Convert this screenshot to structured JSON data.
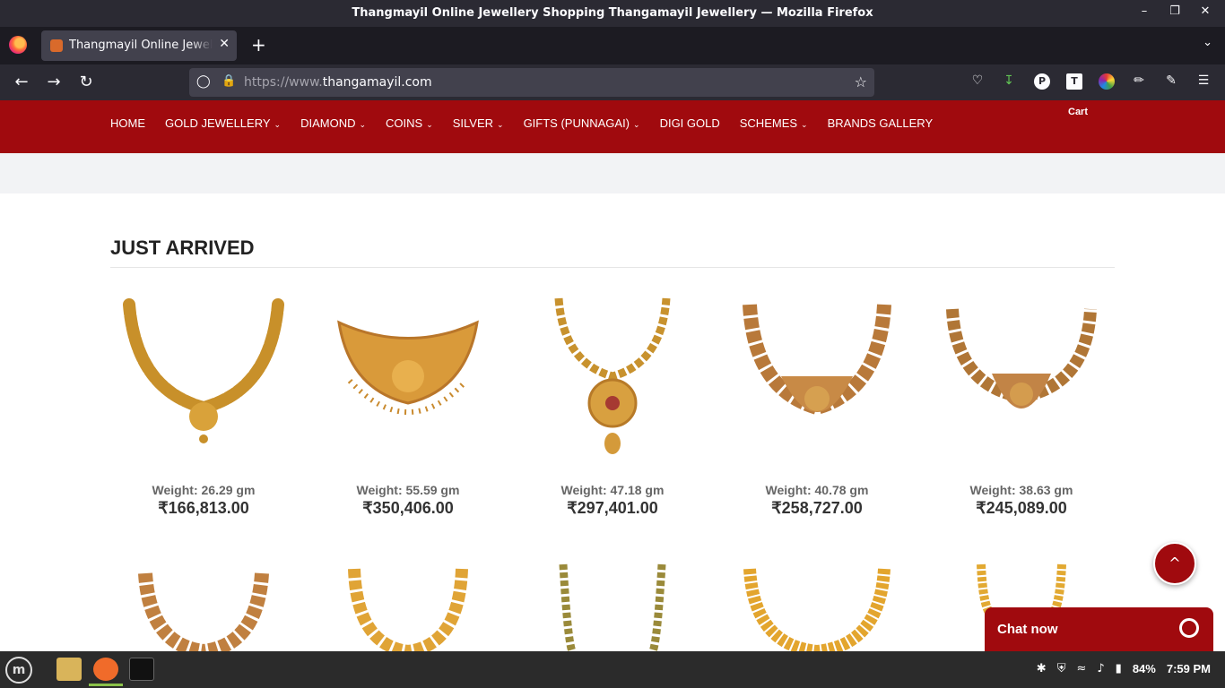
{
  "window": {
    "title": "Thangmayil Online Jewellery Shopping Thangamayil Jewellery — Mozilla Firefox"
  },
  "tab": {
    "label": "Thangmayil Online Jewellery Shopping Thangamayil Jewellery"
  },
  "urlbar": {
    "prefix": "https://www.",
    "domain": "thangamayil.com"
  },
  "site": {
    "menu": [
      {
        "label": "HOME",
        "dropdown": false
      },
      {
        "label": "GOLD JEWELLERY",
        "dropdown": true
      },
      {
        "label": "DIAMOND",
        "dropdown": true
      },
      {
        "label": "COINS",
        "dropdown": true
      },
      {
        "label": "SILVER",
        "dropdown": true
      },
      {
        "label": "GIFTS (PUNNAGAI)",
        "dropdown": true
      },
      {
        "label": "DIGI GOLD",
        "dropdown": false
      },
      {
        "label": "SCHEMES",
        "dropdown": true
      },
      {
        "label": "BRANDS GALLERY",
        "dropdown": false
      }
    ],
    "cart_label": "Cart",
    "brand_color": "#a00a0e"
  },
  "section": {
    "title": "JUST ARRIVED"
  },
  "products": [
    {
      "weight": "Weight: 26.29 gm",
      "price": "₹166,813.00"
    },
    {
      "weight": "Weight: 55.59 gm",
      "price": "₹350,406.00"
    },
    {
      "weight": "Weight: 47.18 gm",
      "price": "₹297,401.00"
    },
    {
      "weight": "Weight: 40.78 gm",
      "price": "₹258,727.00"
    },
    {
      "weight": "Weight: 38.63 gm",
      "price": "₹245,089.00"
    }
  ],
  "scroll_top": {
    "label": "^"
  },
  "chat": {
    "label": "Chat now"
  },
  "taskbar": {
    "battery": "84%",
    "clock": "7:59 PM"
  }
}
